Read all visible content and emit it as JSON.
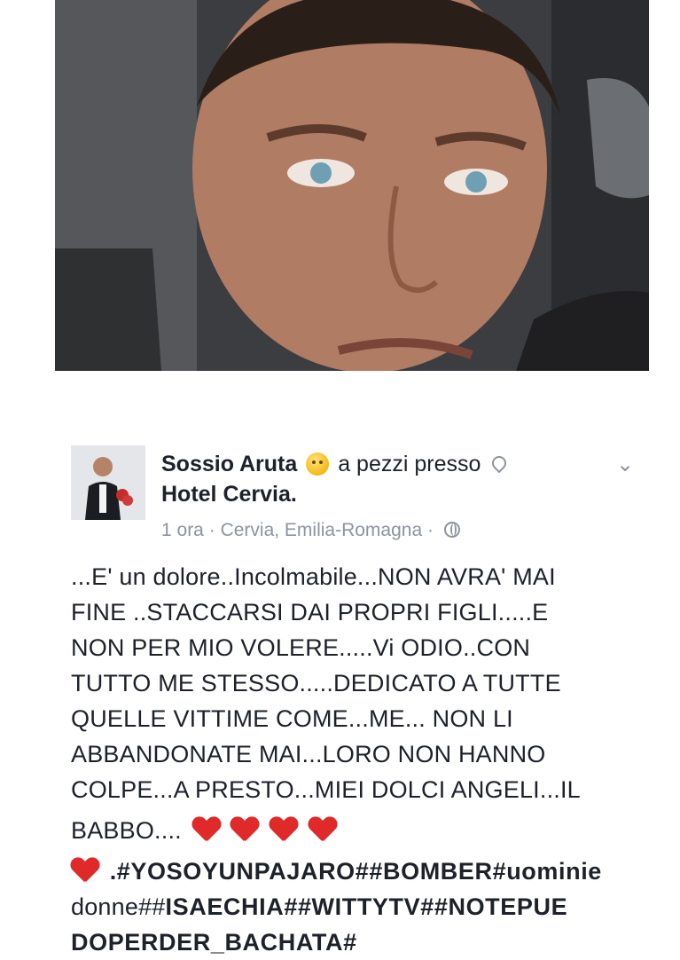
{
  "post": {
    "author": "Sossio Aruta",
    "feeling": "a pezzi presso",
    "place": "Hotel Cervia.",
    "time": "1 ora",
    "separator": "·",
    "location": "Cervia, Emilia-Romagna",
    "lines": [
      "...E' un dolore..Incolmabile...NON AVRA' MAI",
      "FINE ..STACCARSI DAI PROPRI FIGLI.....E",
      "NON PER MIO VOLERE.....Vi ODIO..CON",
      "TUTTO ME STESSO.....DEDICATO A TUTTE",
      "QUELLE VITTIME COME...ME... NON LI",
      "ABBANDONATE MAI...LORO NON HANNO",
      "COLPE...A PRESTO...MIEI DOLCI ANGELI...IL"
    ],
    "closing": "BABBO....",
    "tags_line1": ".#YOSOYUNPAJARO##BOMBER#uominie",
    "tags_line2_a": "donne##",
    "tags_line2_b": "ISAECHIA##WITTYTV##NOTEPUE",
    "tags_line3": "DOPERDER_BACHATA#"
  },
  "icons": {
    "feeling_emoji": "crying-face-icon",
    "location_pin": "location-pin-icon",
    "menu_chevron": "chevron-down-icon",
    "audience": "globe-icon",
    "heart": "red-heart-icon"
  },
  "colors": {
    "text": "#1d2129",
    "meta": "#8d949e",
    "heart": "#e02a2a"
  }
}
